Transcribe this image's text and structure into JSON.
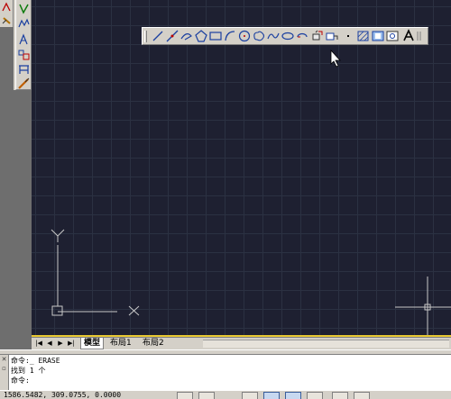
{
  "layout_tabs": {
    "model": "模型",
    "layout1": "布局1",
    "layout2": "布局2"
  },
  "command_window": {
    "lines": [
      "命令:_ ERASE",
      "找到 1 个",
      "命令:"
    ]
  },
  "status_bar": {
    "coordinates": "1586.5482, 309.0755, 0.0000"
  },
  "colors": {
    "canvas_bg": "#1e2031",
    "grid_line": "#2b3142",
    "ucs_icon": "#c8c8c8",
    "accent": "#e8c832"
  },
  "icons": {
    "draw_toolbar": [
      "line-icon",
      "construction-line-icon",
      "polyline-icon",
      "polygon-icon",
      "rectangle-icon",
      "arc-icon",
      "circle-icon",
      "revision-cloud-icon",
      "spline-icon",
      "ellipse-icon",
      "ellipse-arc-icon",
      "insert-block-icon",
      "make-block-icon",
      "point-icon",
      "hatch-icon",
      "region-icon",
      "table-icon",
      "mtext-icon"
    ],
    "modify_toolbar": [
      "erase-icon",
      "copy-icon",
      "mirror-icon",
      "offset-icon",
      "array-icon",
      "stretch-icon"
    ]
  }
}
